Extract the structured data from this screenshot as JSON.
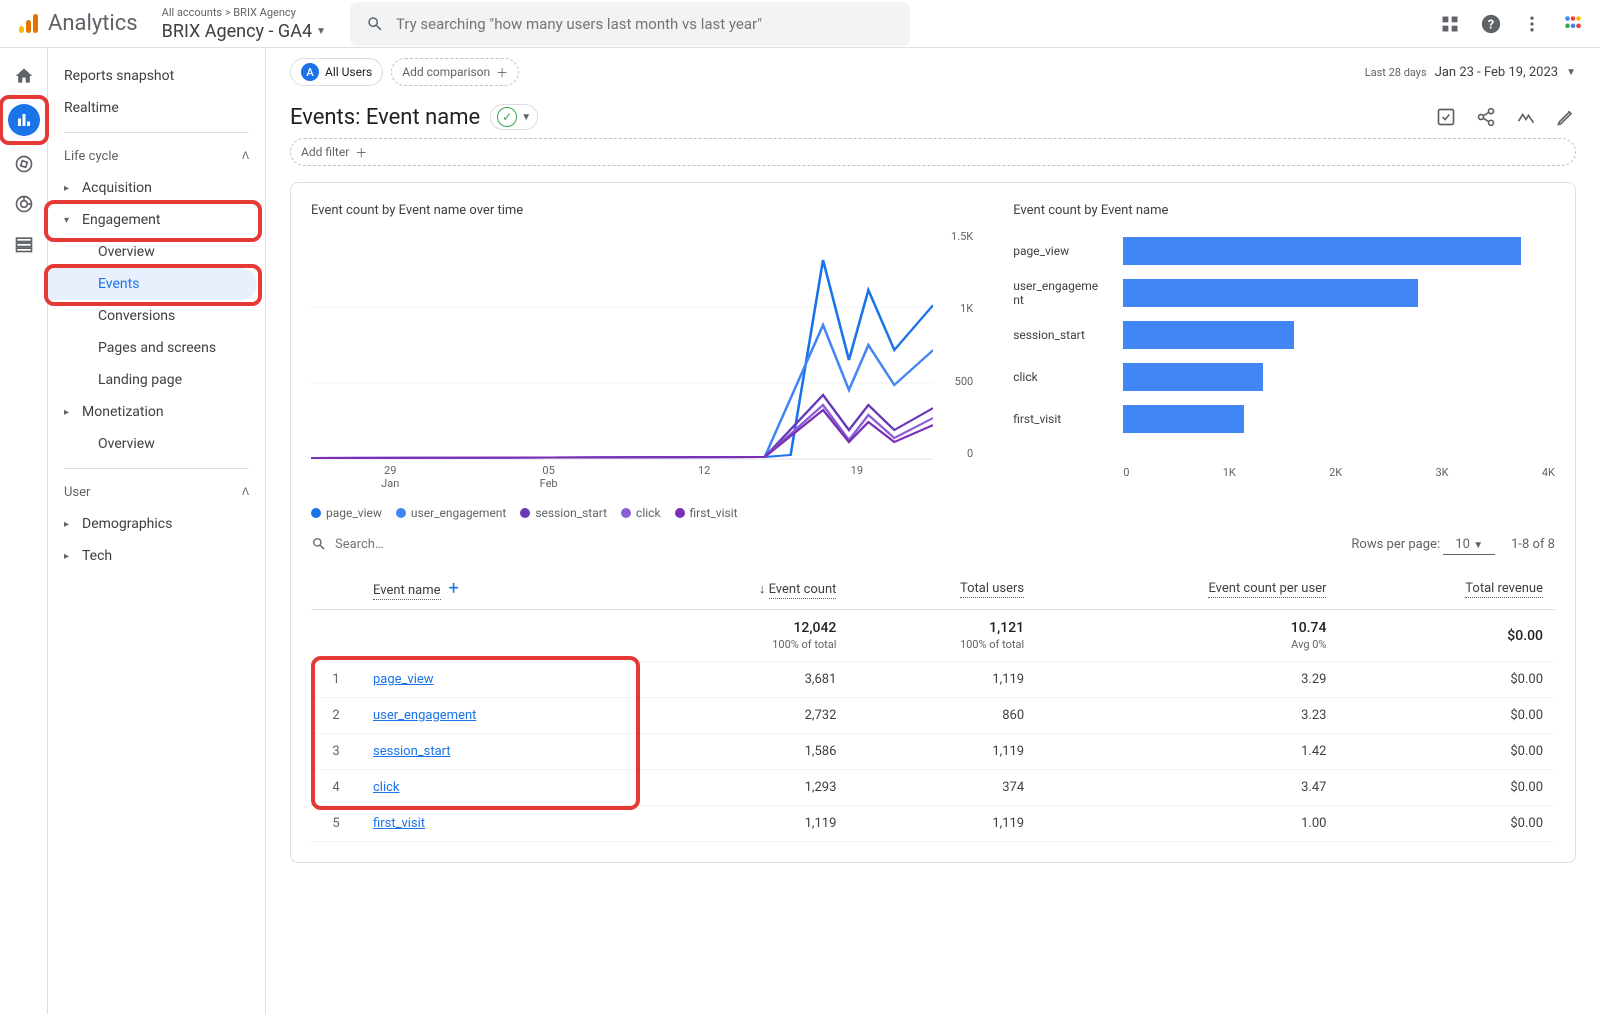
{
  "header": {
    "logo_text": "Analytics",
    "breadcrumb": "All accounts > BRIX Agency",
    "property": "BRIX Agency - GA4",
    "search_placeholder": "Try searching \"how many users last month vs last year\""
  },
  "chip_all": {
    "letter": "A",
    "label": "All Users"
  },
  "chip_add": "Add comparison",
  "date": {
    "label": "Last 28 days",
    "range": "Jan 23 - Feb 19, 2023"
  },
  "page_title": "Events: Event name",
  "add_filter": "Add filter",
  "sidebar": {
    "snapshot": "Reports snapshot",
    "realtime": "Realtime",
    "lifecycle": "Life cycle",
    "acquisition": "Acquisition",
    "engagement": "Engagement",
    "overview": "Overview",
    "events": "Events",
    "conversions": "Conversions",
    "pages": "Pages and screens",
    "landing": "Landing page",
    "monetization": "Monetization",
    "mon_overview": "Overview",
    "user": "User",
    "demographics": "Demographics",
    "tech": "Tech"
  },
  "chart_data": {
    "line": {
      "title": "Event count by Event name over time",
      "x_ticks": [
        "29\nJan",
        "05\nFeb",
        "12",
        "19"
      ],
      "y_ticks": [
        "1.5K",
        "1K",
        "500",
        "0"
      ],
      "ylim": [
        0,
        1500
      ],
      "series": [
        {
          "name": "page_view",
          "color": "#1a73e8"
        },
        {
          "name": "user_engagement",
          "color": "#4285f4"
        },
        {
          "name": "session_start",
          "color": "#6739b7"
        },
        {
          "name": "click",
          "color": "#8a5fd6"
        },
        {
          "name": "first_visit",
          "color": "#7b2fb5"
        }
      ]
    },
    "bar": {
      "title": "Event count by Event name",
      "type": "bar",
      "categories": [
        "page_view",
        "user_engagement",
        "session_start",
        "click",
        "first_visit"
      ],
      "values": [
        3681,
        2732,
        1586,
        1293,
        1119
      ],
      "x_ticks": [
        "0",
        "1K",
        "2K",
        "3K",
        "4K"
      ],
      "xlim": [
        0,
        4000
      ]
    }
  },
  "legend": [
    "page_view",
    "user_engagement",
    "session_start",
    "click",
    "first_visit"
  ],
  "legend_colors": [
    "#1a73e8",
    "#4285f4",
    "#6739b7",
    "#8a5fd6",
    "#7b2fb5"
  ],
  "table": {
    "search_placeholder": "Search…",
    "rows_label": "Rows per page:",
    "rows_value": "10",
    "range": "1-8 of 8",
    "columns": [
      "Event name",
      "Event count",
      "Total users",
      "Event count per user",
      "Total revenue"
    ],
    "totals": {
      "event_count": "12,042",
      "event_count_sub": "100% of total",
      "total_users": "1,121",
      "total_users_sub": "100% of total",
      "per_user": "10.74",
      "per_user_sub": "Avg 0%",
      "revenue": "$0.00"
    },
    "rows": [
      {
        "idx": "1",
        "name": "page_view",
        "count": "3,681",
        "users": "1,119",
        "per": "3.29",
        "rev": "$0.00"
      },
      {
        "idx": "2",
        "name": "user_engagement",
        "count": "2,732",
        "users": "860",
        "per": "3.23",
        "rev": "$0.00"
      },
      {
        "idx": "3",
        "name": "session_start",
        "count": "1,586",
        "users": "1,119",
        "per": "1.42",
        "rev": "$0.00"
      },
      {
        "idx": "4",
        "name": "click",
        "count": "1,293",
        "users": "374",
        "per": "3.47",
        "rev": "$0.00"
      },
      {
        "idx": "5",
        "name": "first_visit",
        "count": "1,119",
        "users": "1,119",
        "per": "1.00",
        "rev": "$0.00"
      }
    ]
  }
}
